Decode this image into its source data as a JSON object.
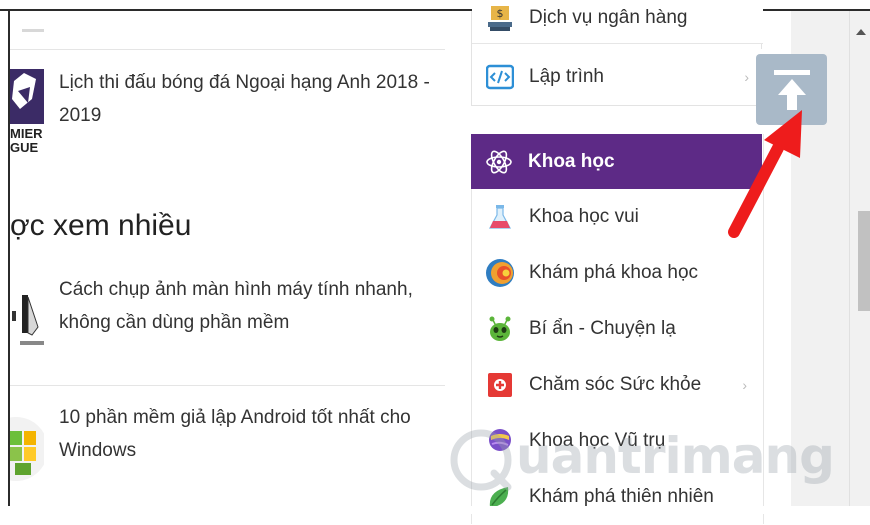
{
  "articles": [
    {
      "title": "Lịch thi đấu bóng đá Ngoại hạng Anh 2018 - 2019",
      "thumb_text": "MIER\nGUE"
    },
    {
      "title": "Cách chụp ảnh màn hình máy tính nhanh, không cần dùng phần mềm"
    },
    {
      "title": "10 phần mềm giả lập Android tốt nhất cho Windows"
    }
  ],
  "section_title": "ợc xem nhiều",
  "menu_top": [
    {
      "label": "Dịch vụ ngân hàng",
      "icon": "bank-icon"
    },
    {
      "label": "Lập trình",
      "icon": "code-icon",
      "has_submenu": true
    }
  ],
  "menu_main": [
    {
      "label": "Khoa học",
      "icon": "atom-icon",
      "active": true
    },
    {
      "label": "Khoa học vui",
      "icon": "flask-icon"
    },
    {
      "label": "Khám phá khoa học",
      "icon": "earth-layers-icon"
    },
    {
      "label": "Bí ẩn - Chuyện lạ",
      "icon": "alien-icon"
    },
    {
      "label": "Chăm sóc Sức khỏe",
      "icon": "health-icon",
      "has_submenu": true
    },
    {
      "label": "Khoa học Vũ trụ",
      "icon": "planet-icon"
    },
    {
      "label": "Khám phá thiên nhiên",
      "icon": "leaf-icon"
    }
  ],
  "watermark": "uantrimang",
  "colors": {
    "accent": "#5d2a86",
    "arrow": "#ee1c1c",
    "scroll_button": "#a9b9c8"
  },
  "chev": "›"
}
